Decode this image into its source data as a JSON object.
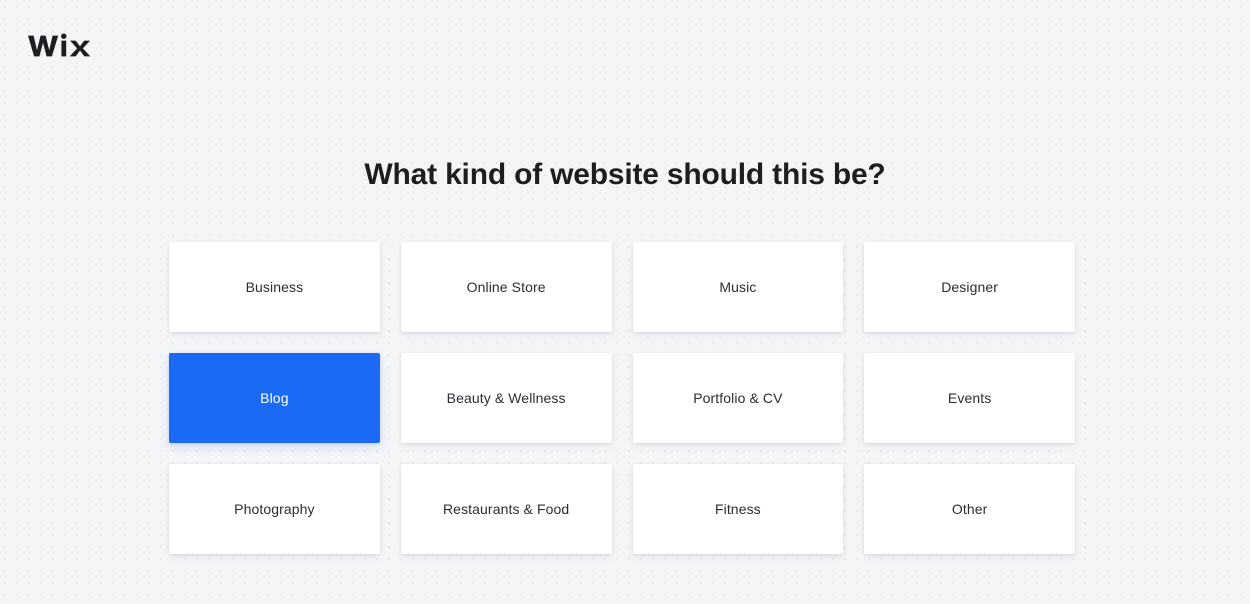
{
  "brand": {
    "logo_text": "WiX",
    "logo_icon": "wix-logo-icon",
    "logo_color": "#1d1e21"
  },
  "page": {
    "background_color": "#f4f5f7",
    "dot_color": "#e6e9ed"
  },
  "heading": {
    "title": "What kind of website should this be?",
    "color": "#1d1e21"
  },
  "selection": {
    "selected_value": "Blog",
    "selected_index": 4,
    "accent_color": "#1a6af5",
    "card_background": "#ffffff",
    "card_text_color": "#2b2d33",
    "selected_text_color": "#ffffff"
  },
  "options": [
    {
      "label": "Business",
      "selected": false
    },
    {
      "label": "Online Store",
      "selected": false
    },
    {
      "label": "Music",
      "selected": false
    },
    {
      "label": "Designer",
      "selected": false
    },
    {
      "label": "Blog",
      "selected": true
    },
    {
      "label": "Beauty & Wellness",
      "selected": false
    },
    {
      "label": "Portfolio & CV",
      "selected": false
    },
    {
      "label": "Events",
      "selected": false
    },
    {
      "label": "Photography",
      "selected": false
    },
    {
      "label": "Restaurants & Food",
      "selected": false
    },
    {
      "label": "Fitness",
      "selected": false
    },
    {
      "label": "Other",
      "selected": false
    }
  ]
}
